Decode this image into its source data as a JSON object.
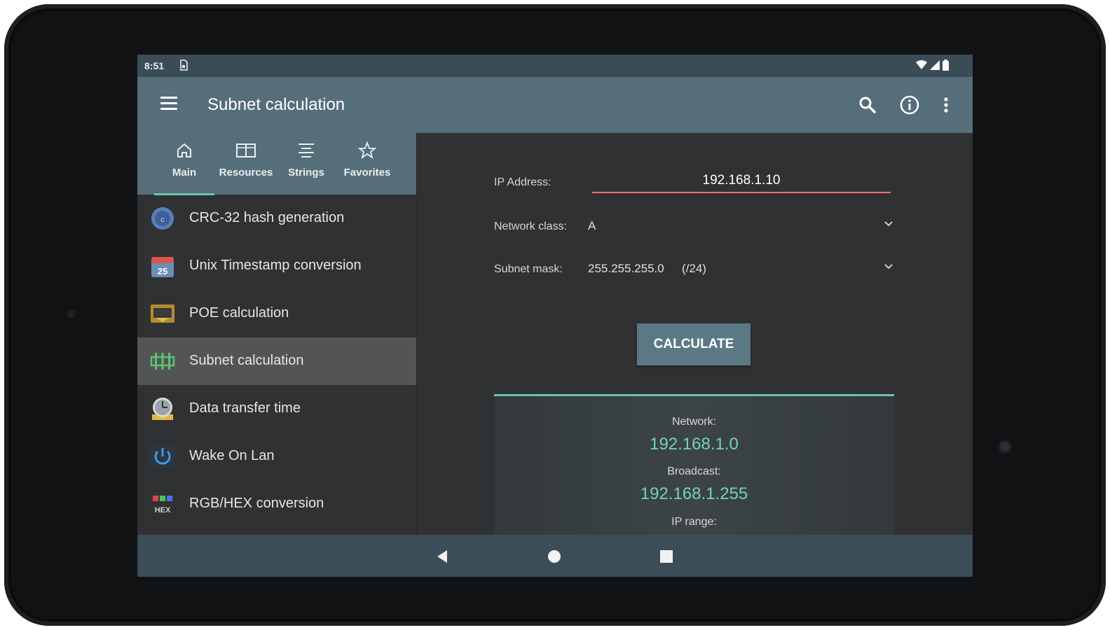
{
  "status": {
    "time": "8:51"
  },
  "appbar": {
    "title": "Subnet calculation"
  },
  "tabs": [
    {
      "label": "Main",
      "icon": "home-icon"
    },
    {
      "label": "Resources",
      "icon": "book-icon"
    },
    {
      "label": "Strings",
      "icon": "strings-icon"
    },
    {
      "label": "Favorites",
      "icon": "star-icon"
    }
  ],
  "menu": [
    {
      "label": "CRC-32 hash generation",
      "icon": "crc-icon"
    },
    {
      "label": "Unix Timestamp conversion",
      "icon": "calendar-icon",
      "icon_text": "25"
    },
    {
      "label": "POE calculation",
      "icon": "poe-icon"
    },
    {
      "label": "Subnet calculation",
      "icon": "subnet-icon",
      "active": true
    },
    {
      "label": "Data transfer time",
      "icon": "clock-icon"
    },
    {
      "label": "Wake On Lan",
      "icon": "power-icon"
    },
    {
      "label": "RGB/HEX conversion",
      "icon": "rgb-hex-icon",
      "icon_text": "HEX"
    }
  ],
  "form": {
    "ip_label": "IP Address:",
    "ip_value": "192.168.1.10",
    "class_label": "Network class:",
    "class_value": "A",
    "mask_label": "Subnet mask:",
    "mask_value": "255.255.255.0",
    "mask_cidr": "(/24)",
    "calc_label": "CALCULATE"
  },
  "result": {
    "network_label": "Network:",
    "network_value": "192.168.1.0",
    "broadcast_label": "Broadcast:",
    "broadcast_value": "192.168.1.255",
    "range_label": "IP range:"
  },
  "colors": {
    "appbar": "#566e7a",
    "accent": "#74d2bd",
    "error_underline": "#ff6e6e",
    "button": "#5b7885"
  }
}
